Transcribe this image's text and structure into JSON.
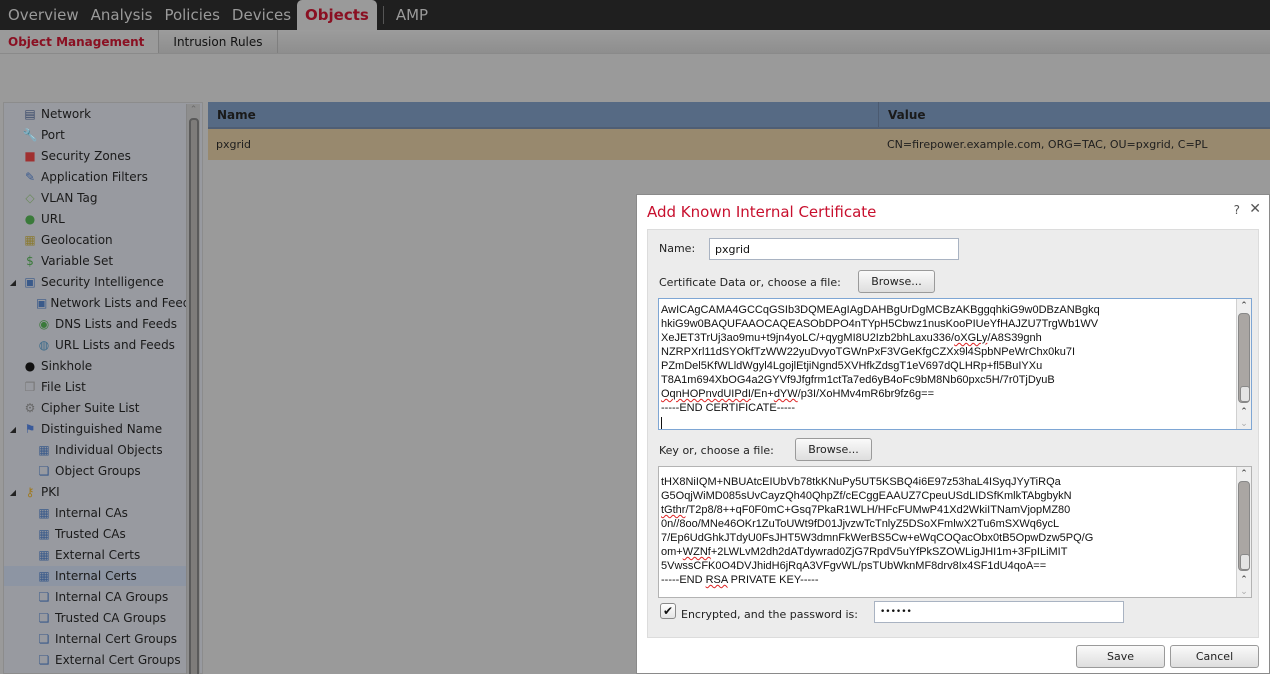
{
  "topnav": {
    "tabs": [
      {
        "label": "Overview",
        "active": false
      },
      {
        "label": "Analysis",
        "active": false
      },
      {
        "label": "Policies",
        "active": false
      },
      {
        "label": "Devices",
        "active": false
      },
      {
        "label": "Objects",
        "active": true
      },
      {
        "label": "AMP",
        "active": false
      }
    ]
  },
  "subnav": {
    "tabs": [
      {
        "label": "Object Management",
        "active": true
      },
      {
        "label": "Intrusion Rules",
        "active": false
      }
    ]
  },
  "sidebar": {
    "items": [
      {
        "label": "Network",
        "icon": "network-icon"
      },
      {
        "label": "Port",
        "icon": "port-icon"
      },
      {
        "label": "Security Zones",
        "icon": "security-zones-icon"
      },
      {
        "label": "Application Filters",
        "icon": "application-filters-icon"
      },
      {
        "label": "VLAN Tag",
        "icon": "tag-icon"
      },
      {
        "label": "URL",
        "icon": "globe-icon"
      },
      {
        "label": "Geolocation",
        "icon": "map-icon"
      },
      {
        "label": "Variable Set",
        "icon": "dollar-icon"
      },
      {
        "label": "Security Intelligence",
        "icon": "monitor-stack-icon",
        "expanded": true
      },
      {
        "label": "Network Lists and Feeds",
        "icon": "monitor-stack-icon",
        "child": true
      },
      {
        "label": "DNS Lists and Feeds",
        "icon": "dns-feed-icon",
        "child": true
      },
      {
        "label": "URL Lists and Feeds",
        "icon": "url-feed-icon",
        "child": true
      },
      {
        "label": "Sinkhole",
        "icon": "sinkhole-icon"
      },
      {
        "label": "File List",
        "icon": "file-list-icon"
      },
      {
        "label": "Cipher Suite List",
        "icon": "gear-icon"
      },
      {
        "label": "Distinguished Name",
        "icon": "distinguished-name-icon",
        "expanded": true
      },
      {
        "label": "Individual Objects",
        "icon": "table-icon",
        "child": true
      },
      {
        "label": "Object Groups",
        "icon": "group-icon",
        "child": true
      },
      {
        "label": "PKI",
        "icon": "key-icon",
        "expanded": true
      },
      {
        "label": "Internal CAs",
        "icon": "table-icon",
        "child": true
      },
      {
        "label": "Trusted CAs",
        "icon": "table-icon",
        "child": true
      },
      {
        "label": "External Certs",
        "icon": "table-icon",
        "child": true
      },
      {
        "label": "Internal Certs",
        "icon": "table-icon",
        "child": true,
        "selected": true
      },
      {
        "label": "Internal CA Groups",
        "icon": "group-icon",
        "child": true
      },
      {
        "label": "Trusted CA Groups",
        "icon": "group-icon",
        "child": true
      },
      {
        "label": "Internal Cert Groups",
        "icon": "group-icon",
        "child": true
      },
      {
        "label": "External Cert Groups",
        "icon": "group-icon",
        "child": true
      }
    ]
  },
  "table": {
    "columns": [
      "Name",
      "Value"
    ],
    "rows": [
      {
        "name": "pxgrid",
        "value": "CN=firepower.example.com, ORG=TAC, OU=pxgrid, C=PL"
      }
    ]
  },
  "dialog": {
    "title": "Add Known Internal Certificate",
    "help": "?",
    "close": "✕",
    "name_label": "Name:",
    "name_value": "pxgrid",
    "cert_label": "Certificate Data or, choose a file:",
    "cert_browse": "Browse...",
    "cert_lines": [
      "AwICAgCAMA4GCCqGSIb3DQMEAgIAgDAHBgUrDgMCBzAKBggqhkiG9w0DBzANBgkq",
      "hkiG9w0BAQUFAAOCAQEASObDPO4nTYpH5Cbwz1nusKooPIUeYfHAJZU7TrgWb1WV",
      "XeJET3TrUj3ao9mu+t9jn4yoLC/+qygMI8U2Izb2bhLaxu336/oXGLy/A8S39gnh",
      "NZRPXrl11dSYOkfTzWW22yuDvyoTGWnPxF3VGeKfgCZXx9l4SpbNPeWrChx0ku7I",
      "PZmDel5KfWLldWgyl4LgojlEtjiNgnd5XVHfkZdsgT1eV697dQLHRp+fl5BuIYXu",
      "T8A1m694XbOG4a2GYVf9Jfgfrm1ctTa7ed6yB4oFc9bM8Nb60pxc5H/7r0TjDyuB",
      "OqnHOPnvdUIPdI/En+dYW/p3I/XoHMv4mR6br9fz6g==",
      "-----END CERTIFICATE-----"
    ],
    "key_label": "Key or, choose a file:",
    "key_browse": "Browse...",
    "key_lines": [
      "tHX8NiIQM+NBUAtcEIUbVb78tkKNuPy5UT5KSBQ4i6E97z53haL4ISyqJYyTiRQa",
      "G5OqjWiMD085sUvCayzQh40QhpZf/cECggEAAUZ7CpeuUSdLIDSfKmlkTAbgbykN",
      "tGthr/T2p8/8++qF0F0mC+Gsq7PkaR1WLH/HFcFUMwP41Xd2WkiITNamVjopMZ80",
      "0n//8oo/MNe46OKr1ZuToUWt9fD01JjvzwTcTnlyZ5DSoXFmlwX2Tu6mSXWq6ycL",
      "7/Ep6UdGhkJTdyU0FsJHT5W3dmnFkWerBS5Cw+eWqCOQacObx0tB5OpwDzw5PQ/G",
      "om+WZNf+2LWLvM2dh2dATdywrad0ZjG7RpdV5uYfPkSZOWLigJHI1m+3FpILiMIT",
      "5VwssCFK0O4DVJhidH6jRqA3VFgvWL/psTUbWknMF8drv8Ix4SF1dU4qoA==",
      "-----END RSA PRIVATE KEY-----"
    ],
    "encrypted_checked": true,
    "encrypted_label": "Encrypted, and the password is:",
    "password_value": "••••••",
    "save": "Save",
    "cancel": "Cancel"
  }
}
